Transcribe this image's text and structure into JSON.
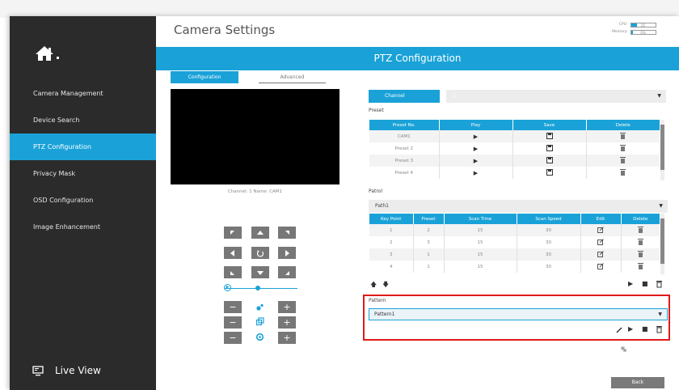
{
  "app": {
    "title": "Camera Settings",
    "banner": "PTZ Configuration"
  },
  "resources": {
    "cpu_label": "CPU:",
    "cpu_value": "25",
    "cpu_fraction": 0.25,
    "memory_label": "Memory:",
    "memory_value": "0%",
    "memory_fraction": 0.08
  },
  "sidebar": {
    "items": [
      {
        "label": "Camera Management"
      },
      {
        "label": "Device Search"
      },
      {
        "label": "PTZ Configuration",
        "active": true
      },
      {
        "label": "Privacy Mask"
      },
      {
        "label": "OSD Configuration"
      },
      {
        "label": "Image Enhancement"
      }
    ],
    "live_view": "Live View"
  },
  "tabs": {
    "configuration": "Configuration",
    "advanced": "Advanced"
  },
  "video": {
    "caption": "Channel: 1   Name: CAM1"
  },
  "channel": {
    "label": "Channel",
    "value": "1"
  },
  "preset": {
    "label": "Preset",
    "columns": [
      "Preset No.",
      "Play",
      "Save",
      "Delete"
    ],
    "rows": [
      {
        "name": "CAM1"
      },
      {
        "name": "Preset 2"
      },
      {
        "name": "Preset 3"
      },
      {
        "name": "Preset 4"
      }
    ]
  },
  "patrol": {
    "label": "Patrol",
    "selected": "Path1",
    "columns": [
      "Key Point",
      "Preset",
      "Scan Time",
      "Scan Speed",
      "Edit",
      "Delete"
    ],
    "rows": [
      {
        "key": "1",
        "preset": "2",
        "time": "15",
        "speed": "30"
      },
      {
        "key": "2",
        "preset": "3",
        "time": "15",
        "speed": "30"
      },
      {
        "key": "3",
        "preset": "1",
        "time": "15",
        "speed": "30"
      },
      {
        "key": "4",
        "preset": "1",
        "time": "15",
        "speed": "30"
      }
    ]
  },
  "pattern": {
    "label": "Pattern",
    "selected": "Pattern1"
  },
  "buttons": {
    "back": "Back"
  },
  "colors": {
    "accent": "#1aa2d8",
    "sidebar": "#2b2b2b",
    "highlight": "#e01a1a"
  }
}
